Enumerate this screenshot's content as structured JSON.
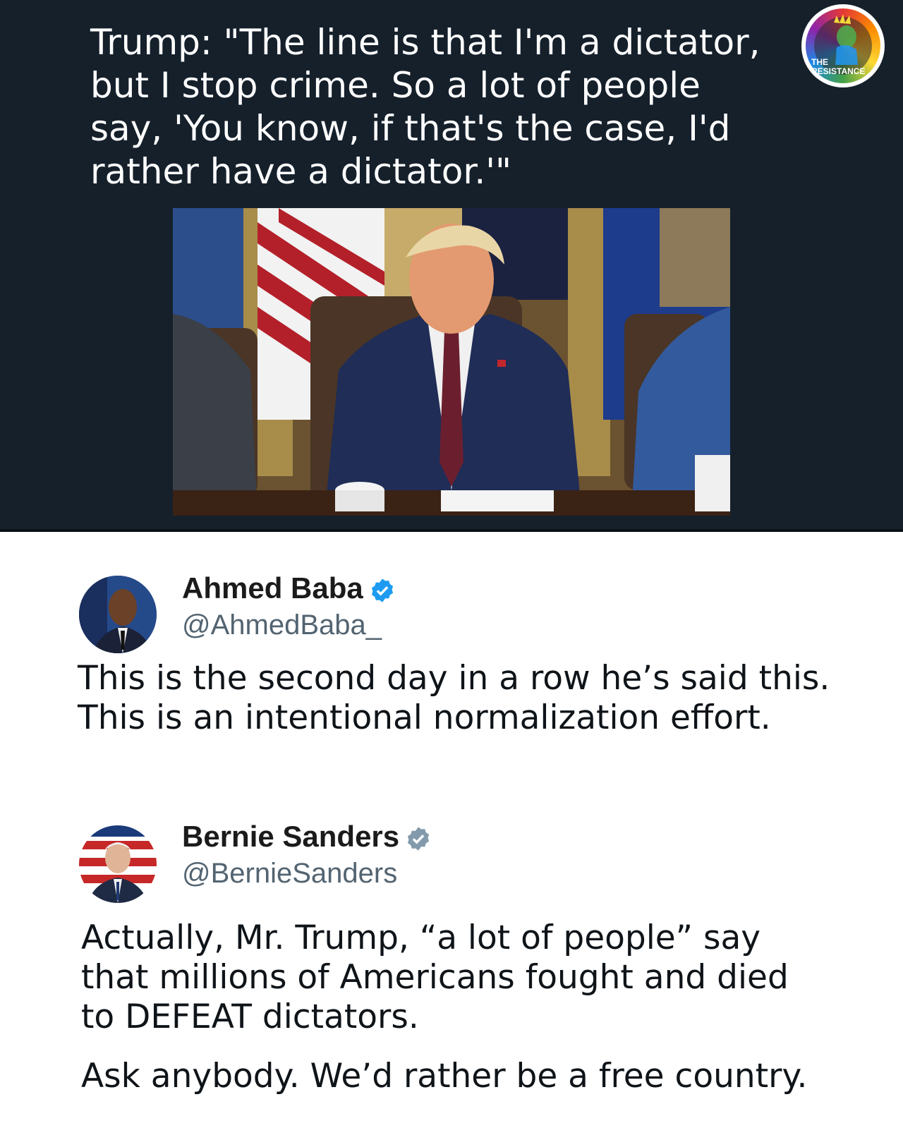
{
  "header": {
    "quote": "Trump: \"The line is that I'm a dictator, but I stop crime. So a lot of people say, 'You know, if that's the case, I'd rather have a dictator.'\"",
    "logo_text_line1": "THE",
    "logo_text_line2": "RESISTANCE"
  },
  "tweets": [
    {
      "name": "Ahmed Baba",
      "handle": "@AhmedBaba_",
      "verified": true,
      "badge_color": "#1d9bf0",
      "text_lines": [
        "This is the second day in a row he’s said this.",
        "This is an intentional normalization effort."
      ]
    },
    {
      "name": "Bernie Sanders",
      "handle": "@BernieSanders",
      "verified": true,
      "badge_color": "#829aab",
      "paragraph1_lines": [
        "Actually, Mr. Trump, “a lot of people” say",
        "that millions of Americans fought and died",
        "to DEFEAT dictators."
      ],
      "paragraph2": "Ask anybody. We’d rather be a free country."
    }
  ],
  "colors": {
    "top_background": "#15202b",
    "handle": "#536471",
    "text": "#0f1419"
  }
}
